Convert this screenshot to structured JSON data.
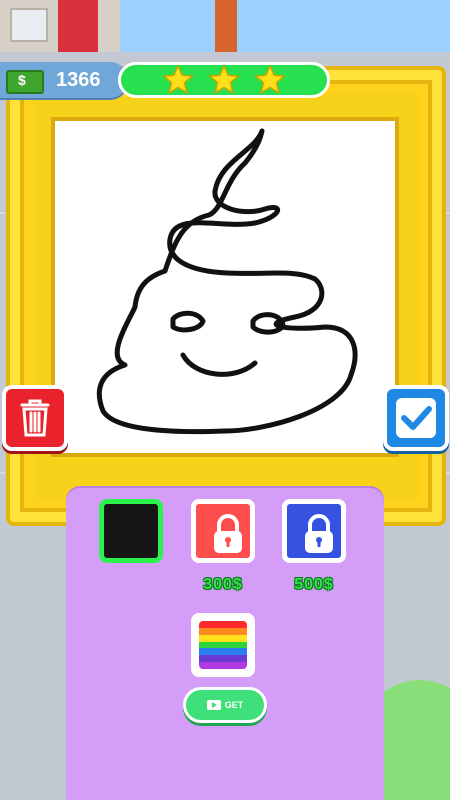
{
  "hud": {
    "money_icon_symbol": "$",
    "money_value": "1366",
    "stars": 3,
    "star_color": "#ffdd1a"
  },
  "canvas": {
    "drawing_subject": "poop-emoji doodle",
    "stroke_color": "#111111"
  },
  "buttons": {
    "trash_icon": "trash-icon",
    "confirm_icon": "check-icon"
  },
  "palette": {
    "swatches": [
      {
        "name": "black",
        "color": "#161616",
        "selected": true,
        "locked": false
      },
      {
        "name": "red",
        "color": "#ff4e4e",
        "selected": false,
        "locked": true,
        "price": "300$"
      },
      {
        "name": "blue",
        "color": "#3553e0",
        "selected": false,
        "locked": true,
        "price": "500$"
      },
      {
        "name": "rainbow",
        "selected": false,
        "locked": false,
        "colors": [
          "#ff2a2a",
          "#ff8a1e",
          "#ffe11e",
          "#2dd43a",
          "#2a7ef0",
          "#6a3ad6",
          "#b13ae0"
        ]
      }
    ],
    "get_button_label": "GET"
  },
  "colors": {
    "frame": "#f7d21a",
    "panel": "#d49ef8",
    "hud_green": "#27e04f",
    "trash_red": "#e9222b",
    "confirm_blue": "#1e88e5"
  }
}
